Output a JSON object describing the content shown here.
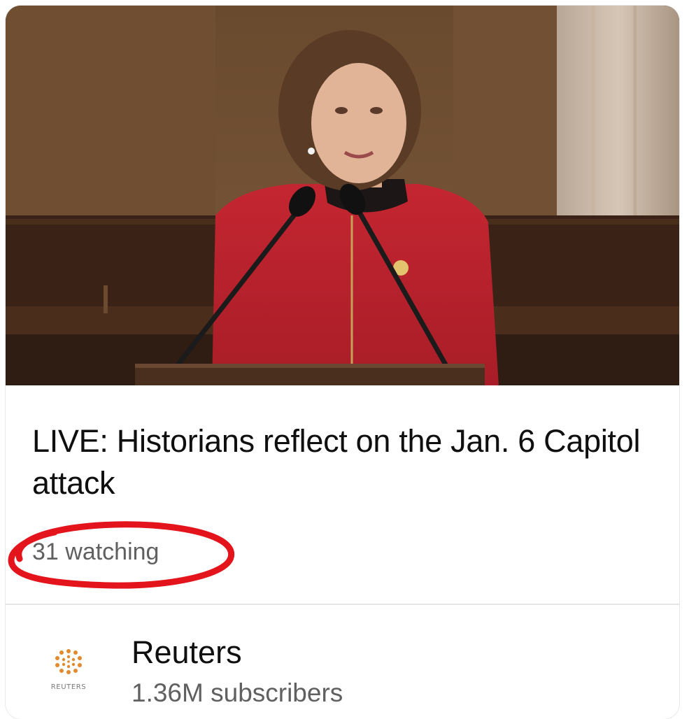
{
  "video": {
    "thumbnail_alt": "",
    "title": "LIVE: Historians reflect on the Jan. 6 Capitol attack",
    "watching": "31 watching"
  },
  "channel": {
    "name": "Reuters",
    "subscribers": "1.36M subscribers",
    "logo_text": "REUTERS"
  },
  "colors": {
    "highlight_circle": "#e3141b",
    "title_text": "#0f0f0f",
    "secondary_text": "#606060"
  }
}
